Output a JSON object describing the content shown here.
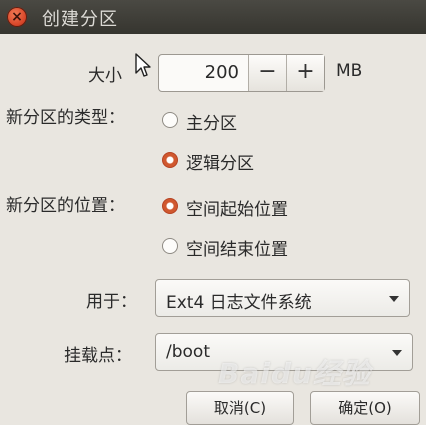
{
  "window": {
    "title": "创建分区",
    "close_glyph": "×"
  },
  "size": {
    "label": "大小",
    "value": "200",
    "decrement": "−",
    "increment": "+",
    "unit": "MB"
  },
  "partition_type": {
    "label": "新分区的类型：",
    "options": [
      {
        "label": "主分区",
        "selected": false
      },
      {
        "label": "逻辑分区",
        "selected": true
      }
    ]
  },
  "partition_location": {
    "label": "新分区的位置：",
    "options": [
      {
        "label": "空间起始位置",
        "selected": true
      },
      {
        "label": "空间结束位置",
        "selected": false
      }
    ]
  },
  "use_as": {
    "label": "用于：",
    "value": "Ext4 日志文件系统"
  },
  "mount_point": {
    "label": "挂载点：",
    "value": "/boot"
  },
  "buttons": {
    "cancel": "取消(C)",
    "ok": "确定(O)"
  },
  "watermark": {
    "text": "Baidu经验"
  },
  "icons": {
    "close": "close-icon",
    "pointer": "mouse-pointer-icon",
    "dropdown": "chevron-down-icon"
  },
  "colors": {
    "titlebar": "#3f3e38",
    "radio_selected": "#d0582f",
    "close_button": "#d9472a"
  }
}
